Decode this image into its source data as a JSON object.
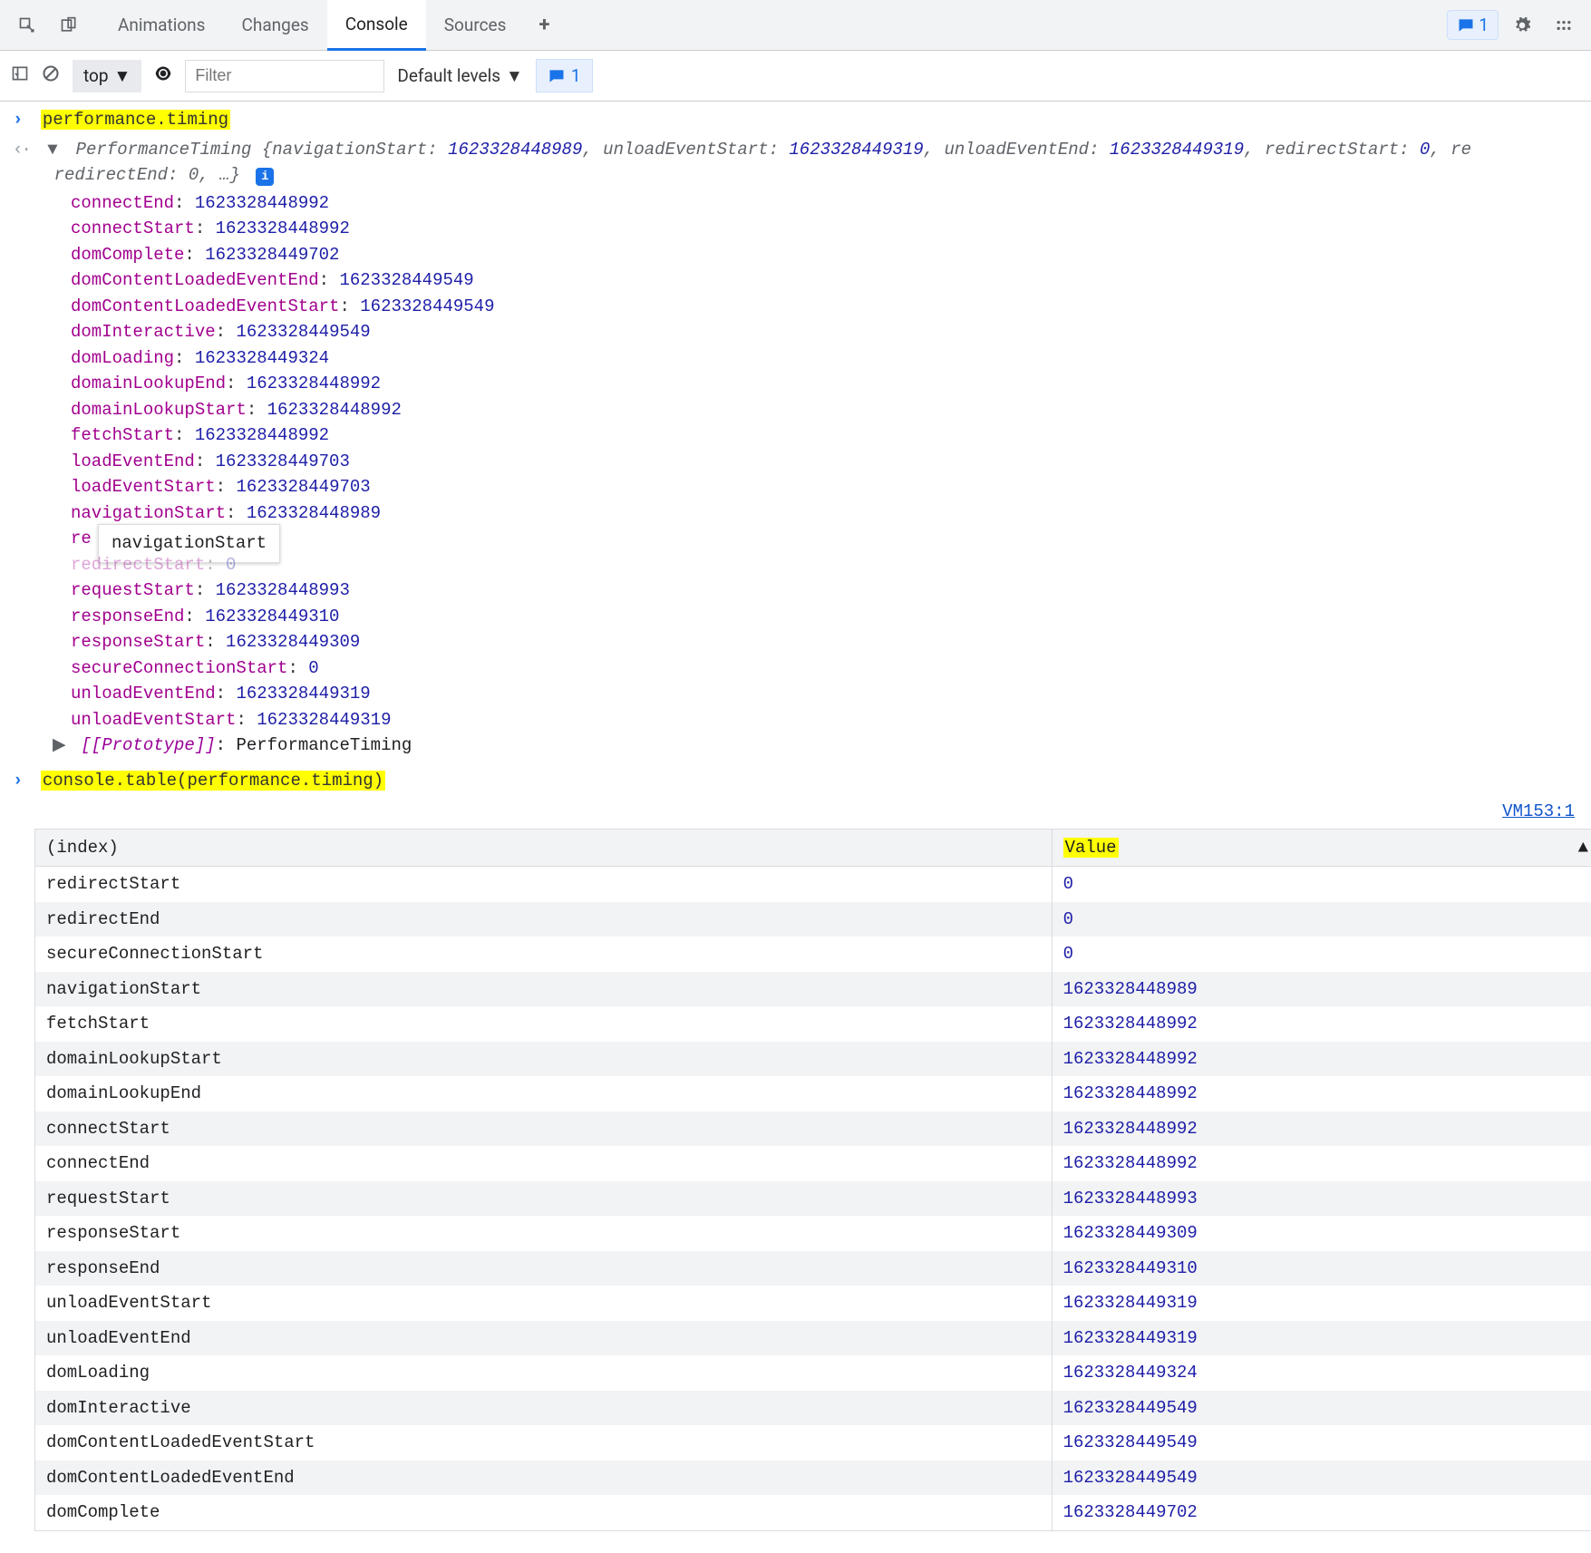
{
  "toolbar": {
    "tabs": [
      "Animations",
      "Changes",
      "Console",
      "Sources"
    ],
    "active_tab": "Console",
    "message_count": "1"
  },
  "subtoolbar": {
    "context": "top",
    "filter_placeholder": "Filter",
    "levels_label": "Default levels",
    "issues_count": "1"
  },
  "input1": "performance.timing",
  "preview": {
    "type": "PerformanceTiming",
    "pairs": [
      {
        "k": "navigationStart",
        "v": "1623328448989"
      },
      {
        "k": "unloadEventStart",
        "v": "1623328449319"
      },
      {
        "k": "unloadEventEnd",
        "v": "1623328449319"
      },
      {
        "k": "redirectStart",
        "v": "0"
      }
    ],
    "cont": "redirectEnd: 0, …"
  },
  "props": [
    {
      "k": "connectEnd",
      "v": "1623328448992"
    },
    {
      "k": "connectStart",
      "v": "1623328448992"
    },
    {
      "k": "domComplete",
      "v": "1623328449702"
    },
    {
      "k": "domContentLoadedEventEnd",
      "v": "1623328449549"
    },
    {
      "k": "domContentLoadedEventStart",
      "v": "1623328449549"
    },
    {
      "k": "domInteractive",
      "v": "1623328449549"
    },
    {
      "k": "domLoading",
      "v": "1623328449324"
    },
    {
      "k": "domainLookupEnd",
      "v": "1623328448992"
    },
    {
      "k": "domainLookupStart",
      "v": "1623328448992"
    },
    {
      "k": "fetchStart",
      "v": "1623328448992"
    },
    {
      "k": "loadEventEnd",
      "v": "1623328449703"
    },
    {
      "k": "loadEventStart",
      "v": "1623328449703"
    },
    {
      "k": "navigationStart",
      "v": "1623328448989"
    },
    {
      "k": "re",
      "v": "",
      "tooltip": "navigationStart"
    },
    {
      "k": "redirectStart",
      "v": "0",
      "strike": true
    },
    {
      "k": "requestStart",
      "v": "1623328448993"
    },
    {
      "k": "responseEnd",
      "v": "1623328449310"
    },
    {
      "k": "responseStart",
      "v": "1623328449309"
    },
    {
      "k": "secureConnectionStart",
      "v": "0"
    },
    {
      "k": "unloadEventEnd",
      "v": "1623328449319"
    },
    {
      "k": "unloadEventStart",
      "v": "1623328449319"
    }
  ],
  "proto": {
    "label": "[[Prototype]]",
    "value": "PerformanceTiming"
  },
  "input2": "console.table(performance.timing)",
  "source_link": "VM153:1",
  "table": {
    "headers": [
      "(index)",
      "Value"
    ],
    "rows": [
      {
        "k": "redirectStart",
        "v": "0"
      },
      {
        "k": "redirectEnd",
        "v": "0"
      },
      {
        "k": "secureConnectionStart",
        "v": "0"
      },
      {
        "k": "navigationStart",
        "v": "1623328448989"
      },
      {
        "k": "fetchStart",
        "v": "1623328448992"
      },
      {
        "k": "domainLookupStart",
        "v": "1623328448992"
      },
      {
        "k": "domainLookupEnd",
        "v": "1623328448992"
      },
      {
        "k": "connectStart",
        "v": "1623328448992"
      },
      {
        "k": "connectEnd",
        "v": "1623328448992"
      },
      {
        "k": "requestStart",
        "v": "1623328448993"
      },
      {
        "k": "responseStart",
        "v": "1623328449309"
      },
      {
        "k": "responseEnd",
        "v": "1623328449310"
      },
      {
        "k": "unloadEventStart",
        "v": "1623328449319"
      },
      {
        "k": "unloadEventEnd",
        "v": "1623328449319"
      },
      {
        "k": "domLoading",
        "v": "1623328449324"
      },
      {
        "k": "domInteractive",
        "v": "1623328449549"
      },
      {
        "k": "domContentLoadedEventStart",
        "v": "1623328449549"
      },
      {
        "k": "domContentLoadedEventEnd",
        "v": "1623328449549"
      },
      {
        "k": "domComplete",
        "v": "1623328449702"
      }
    ]
  }
}
